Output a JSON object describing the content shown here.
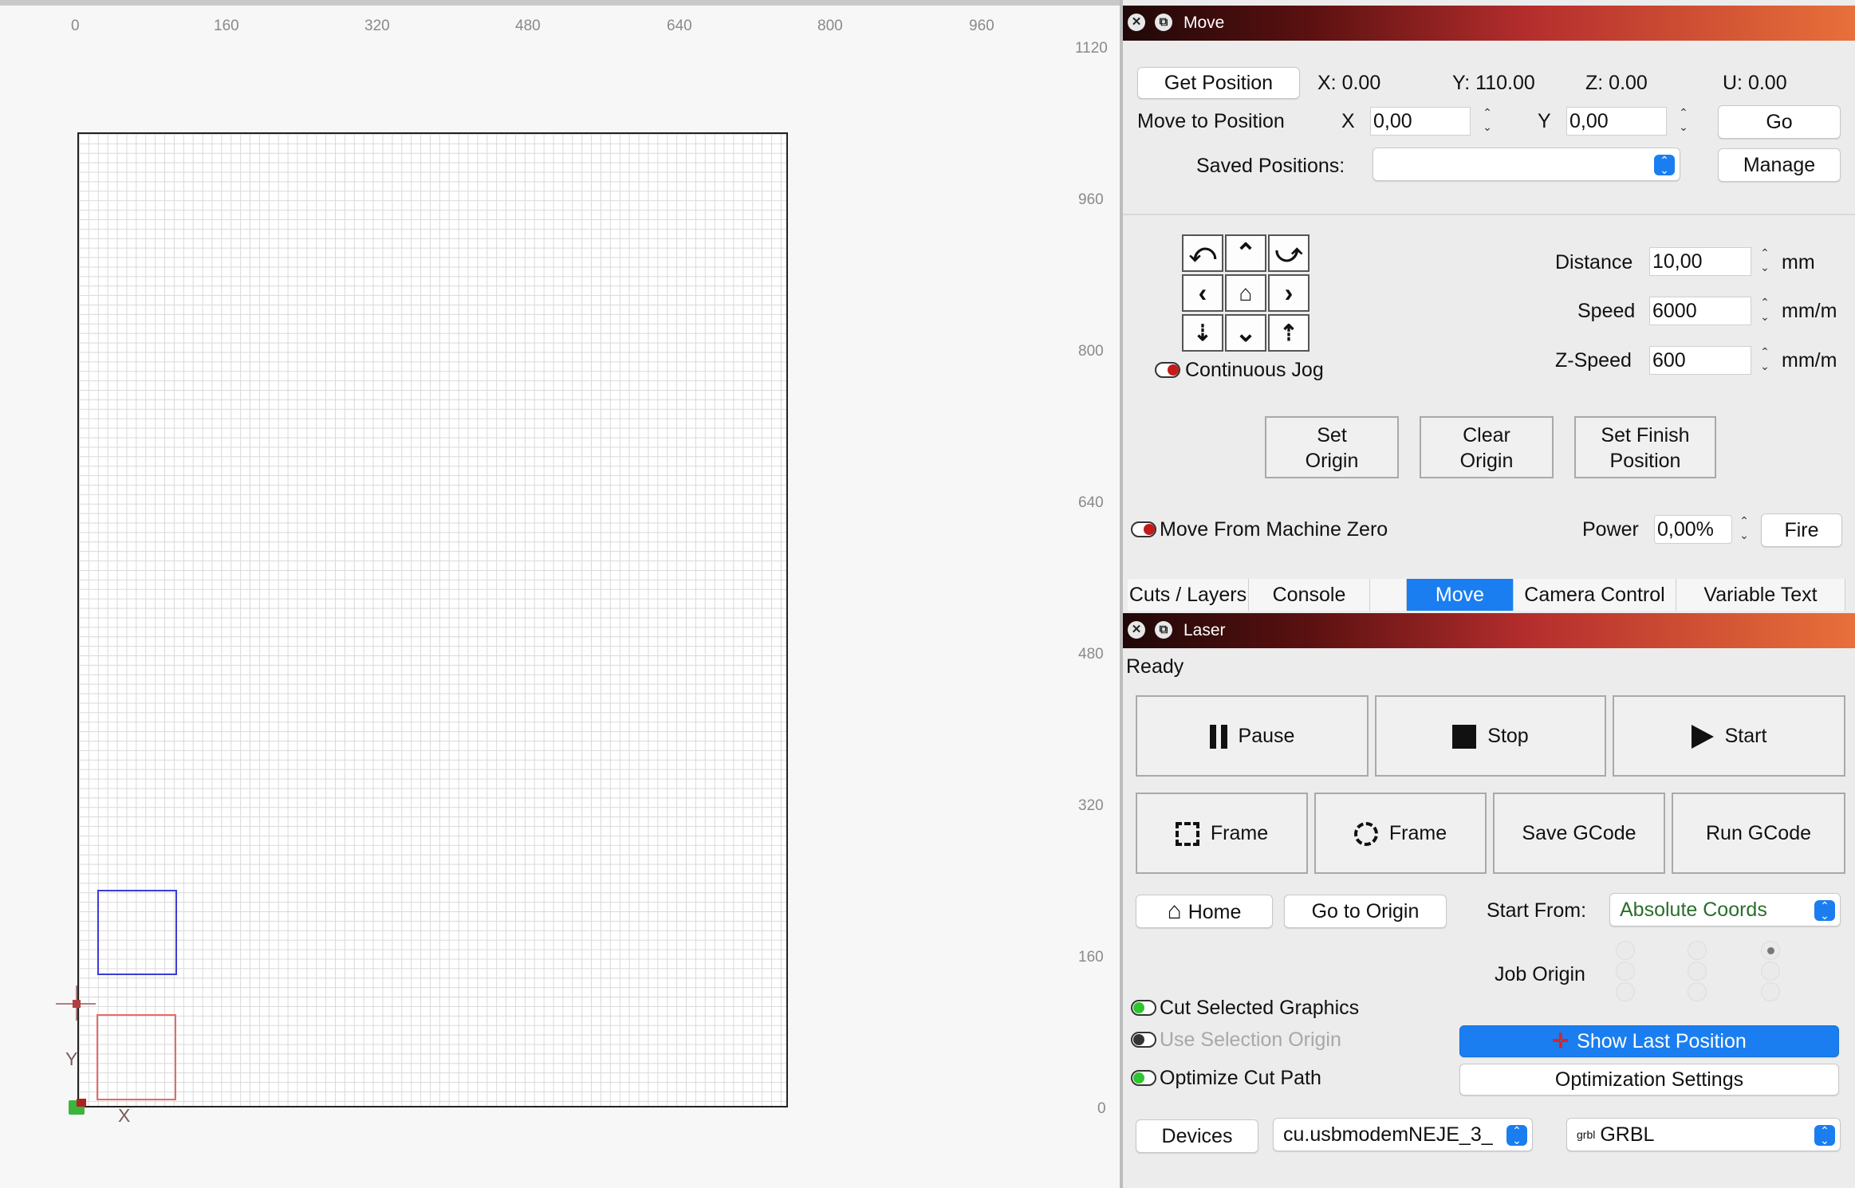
{
  "ruler": {
    "x_ticks": [
      "0",
      "160",
      "320",
      "480",
      "640",
      "800",
      "960"
    ],
    "y_ticks": [
      "1120",
      "960",
      "800",
      "640",
      "480",
      "320",
      "160",
      "0"
    ]
  },
  "canvas": {
    "x_axis": "X",
    "y_axis": "Y"
  },
  "move_panel": {
    "title": "Move",
    "get_position": "Get Position",
    "pos_x": "X: 0.00",
    "pos_y": "Y: 110.00",
    "pos_z": "Z: 0.00",
    "pos_u": "U: 0.00",
    "move_to_position": "Move to Position",
    "x_label": "X",
    "x_value": "0,00",
    "y_label": "Y",
    "y_value": "0,00",
    "go": "Go",
    "saved_positions": "Saved Positions:",
    "saved_value": "",
    "manage": "Manage",
    "distance_label": "Distance",
    "distance_value": "10,00",
    "distance_unit": "mm",
    "speed_label": "Speed",
    "speed_value": "6000",
    "speed_unit": "mm/m",
    "zspeed_label": "Z-Speed",
    "zspeed_value": "600",
    "zspeed_unit": "mm/m",
    "continuous_jog": "Continuous Jog",
    "set_origin": [
      "Set",
      "Origin"
    ],
    "clear_origin": [
      "Clear",
      "Origin"
    ],
    "set_finish": [
      "Set Finish",
      "Position"
    ],
    "move_from_zero": "Move From Machine Zero",
    "power_label": "Power",
    "power_value": "0,00%",
    "fire": "Fire"
  },
  "tabs": [
    {
      "label": "Cuts / Layers"
    },
    {
      "label": "Console"
    },
    {
      "label": "Move",
      "active": true
    },
    {
      "label": "Camera Control"
    },
    {
      "label": "Variable Text"
    }
  ],
  "laser_panel": {
    "title": "Laser",
    "status": "Ready",
    "pause": "Pause",
    "stop": "Stop",
    "start": "Start",
    "frame1": "Frame",
    "frame2": "Frame",
    "save_gcode": "Save GCode",
    "run_gcode": "Run GCode",
    "home": "Home",
    "go_to_origin": "Go to Origin",
    "start_from_label": "Start From:",
    "start_from_value": "Absolute Coords",
    "job_origin": "Job Origin",
    "cut_selected": "Cut Selected Graphics",
    "use_selection_origin": "Use Selection Origin",
    "optimize_cut_path": "Optimize Cut Path",
    "show_last_position": "Show Last Position",
    "optimization_settings": "Optimization Settings",
    "devices": "Devices",
    "port": "cu.usbmodemNEJE_3_",
    "controller_prefix": "grbl",
    "controller": "GRBL"
  },
  "colors": {
    "accent": "#1a7ef0",
    "toggle_on": "#2fc52f",
    "toggle_off": "#c41a1a"
  }
}
